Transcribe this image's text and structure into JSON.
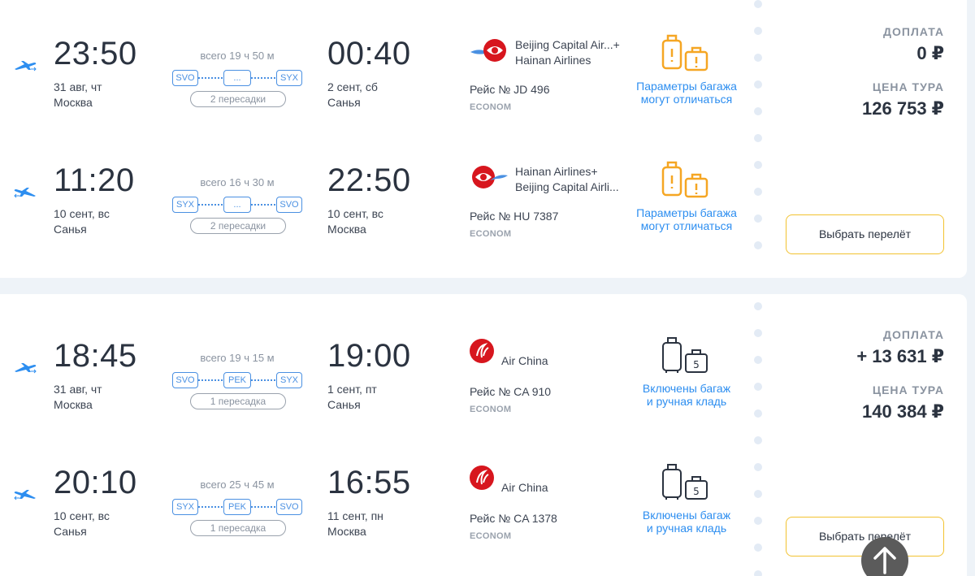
{
  "offers": [
    {
      "segments": [
        {
          "direction": "outbound",
          "dep_time": "23:50",
          "dep_date": "31 авг, чт",
          "dep_city": "Москва",
          "duration": "всего 19 ч 50 м",
          "route": [
            "SVO",
            "...",
            "SYX"
          ],
          "stops": "2 пересадки",
          "arr_time": "00:40",
          "arr_date": "2 сент, сб",
          "arr_city": "Санья",
          "airline_line1": "Beijing Capital Air...+",
          "airline_line2": "Hainan Airlines",
          "flight": "Рейс № JD 496",
          "class": "ECONOM",
          "baggage_line1": "Параметры багажа",
          "baggage_line2": "могут отличаться"
        },
        {
          "direction": "return",
          "dep_time": "11:20",
          "dep_date": "10 сент, вс",
          "dep_city": "Санья",
          "duration": "всего 16 ч 30 м",
          "route": [
            "SYX",
            "...",
            "SVO"
          ],
          "stops": "2 пересадки",
          "arr_time": "22:50",
          "arr_date": "10 сент, вс",
          "arr_city": "Москва",
          "airline_line1": "Hainan Airlines+",
          "airline_line2": "Beijing Capital Airli...",
          "flight": "Рейс № HU 7387",
          "class": "ECONOM",
          "baggage_line1": "Параметры багажа",
          "baggage_line2": "могут отличаться"
        }
      ],
      "surcharge_label": "ДОПЛАТА",
      "surcharge": "0 ₽",
      "price_label": "ЦЕНА ТУРА",
      "price": "126 753 ₽",
      "select_label": "Выбрать перелёт"
    },
    {
      "segments": [
        {
          "direction": "outbound",
          "dep_time": "18:45",
          "dep_date": "31 авг, чт",
          "dep_city": "Москва",
          "duration": "всего 19 ч 15 м",
          "route": [
            "SVO",
            "PEK",
            "SYX"
          ],
          "stops": "1 пересадка",
          "arr_time": "19:00",
          "arr_date": "1 сент, пт",
          "arr_city": "Санья",
          "airline_line1": "Air China",
          "flight": "Рейс № CA 910",
          "class": "ECONOM",
          "baggage_line1": "Включены багаж",
          "baggage_line2": "и ручная кладь"
        },
        {
          "direction": "return",
          "dep_time": "20:10",
          "dep_date": "10 сент, вс",
          "dep_city": "Санья",
          "duration": "всего 25 ч 45 м",
          "route": [
            "SYX",
            "PEK",
            "SVO"
          ],
          "stops": "1 пересадка",
          "arr_time": "16:55",
          "arr_date": "11 сент, пн",
          "arr_city": "Москва",
          "airline_line1": "Air China",
          "flight": "Рейс № CA 1378",
          "class": "ECONOM",
          "baggage_line1": "Включены багаж",
          "baggage_line2": "и ручная кладь"
        }
      ],
      "surcharge_label": "ДОПЛАТА",
      "surcharge": "+ 13 631 ₽",
      "price_label": "ЦЕНА ТУРА",
      "price": "140 384 ₽",
      "select_label": "Выбрать перелёт"
    }
  ],
  "colors": {
    "accent": "#4a90e2",
    "link": "#2d8ef0",
    "baggage_warn": "#f5a623",
    "button_border": "#f2c230",
    "air_china": "#d7161e"
  },
  "icons": {
    "outbound": "plane-takeoff-icon",
    "return": "plane-landing-icon",
    "baggage_warn": "suitcase-warning-icon",
    "baggage_ok": "suitcase-included-icon",
    "scroll_up": "arrow-up-icon"
  }
}
